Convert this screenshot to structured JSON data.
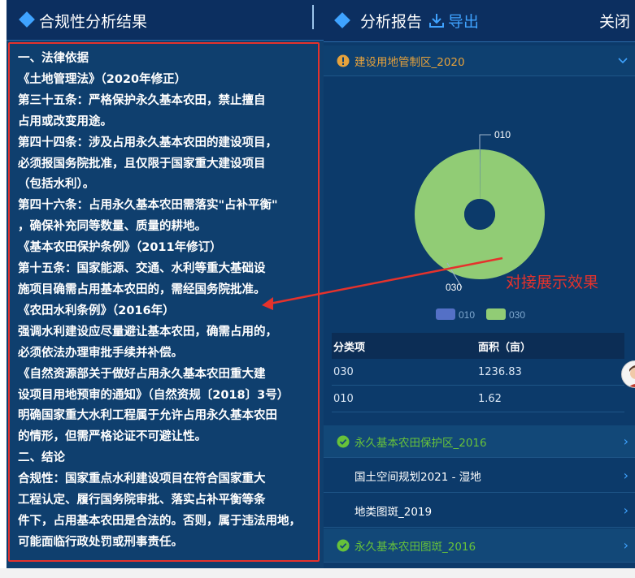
{
  "left_panel": {
    "title": "合规性分析结果",
    "lines": [
      "一、法律依据",
      "《土地管理法》（2020年修正）",
      "第三十五条：严格保护永久基本农田，禁止擅自",
      "占用或改变用途。",
      "第四十四条：涉及占用永久基本农田的建设项目，",
      "必须报国务院批准，且仅限于国家重大建设项目",
      "（包括水利）。",
      "第四十六条：占用永久基本农田需落实\"占补平衡\"",
      "，确保补充同等数量、质量的耕地。",
      "《基本农田保护条例》（2011年修订）",
      "第十五条：国家能源、交通、水利等重大基础设",
      "施项目确需占用基本农田的，需经国务院批准。",
      "《农田水利条例》（2016年）",
      "强调水利建设应尽量避让基本农田，确需占用的，",
      "必须依法办理审批手续并补偿。",
      "《自然资源部关于做好占用永久基本农田重大建",
      "设项目用地预审的通知》（自然资规〔2018〕3号）",
      "明确国家重大水利工程属于允许占用永久基本农田",
      "的情形，但需严格论证不可避让性。",
      "二、结论",
      "合规性：国家重点水利建设项目在符合国家重大",
      "工程认定、履行国务院审批、落实占补平衡等条",
      "件下，占用基本农田是合法的。否则，属于违法用地，",
      "可能面临行政处罚或刑事责任。"
    ]
  },
  "right_panel": {
    "title": "分析报告",
    "export_label": "导出",
    "close_label": "关闭",
    "construction_zone": {
      "label": "建设用地管制区_2020",
      "status_color": "#e6a23c"
    },
    "annotation": "对接展示效果",
    "table": {
      "headers": [
        "分类项",
        "面积（亩）"
      ],
      "rows": [
        {
          "category": "030",
          "area": "1236.83"
        },
        {
          "category": "010",
          "area": "1.62"
        }
      ]
    },
    "items": {
      "farmland_protection": "永久基本农田保护区_2016",
      "land_planning": "国土空间规划2021 - 湿地",
      "land_type": "地类图斑_2019",
      "farmland_patch": "永久基本农田图斑_2016"
    }
  },
  "chart_data": {
    "type": "pie",
    "categories": [
      "010",
      "030"
    ],
    "values": [
      1.62,
      1236.83
    ],
    "colors": [
      "#5470c6",
      "#91cc75"
    ],
    "legend": [
      "010",
      "030"
    ],
    "legend_position": "bottom",
    "donut": true
  }
}
